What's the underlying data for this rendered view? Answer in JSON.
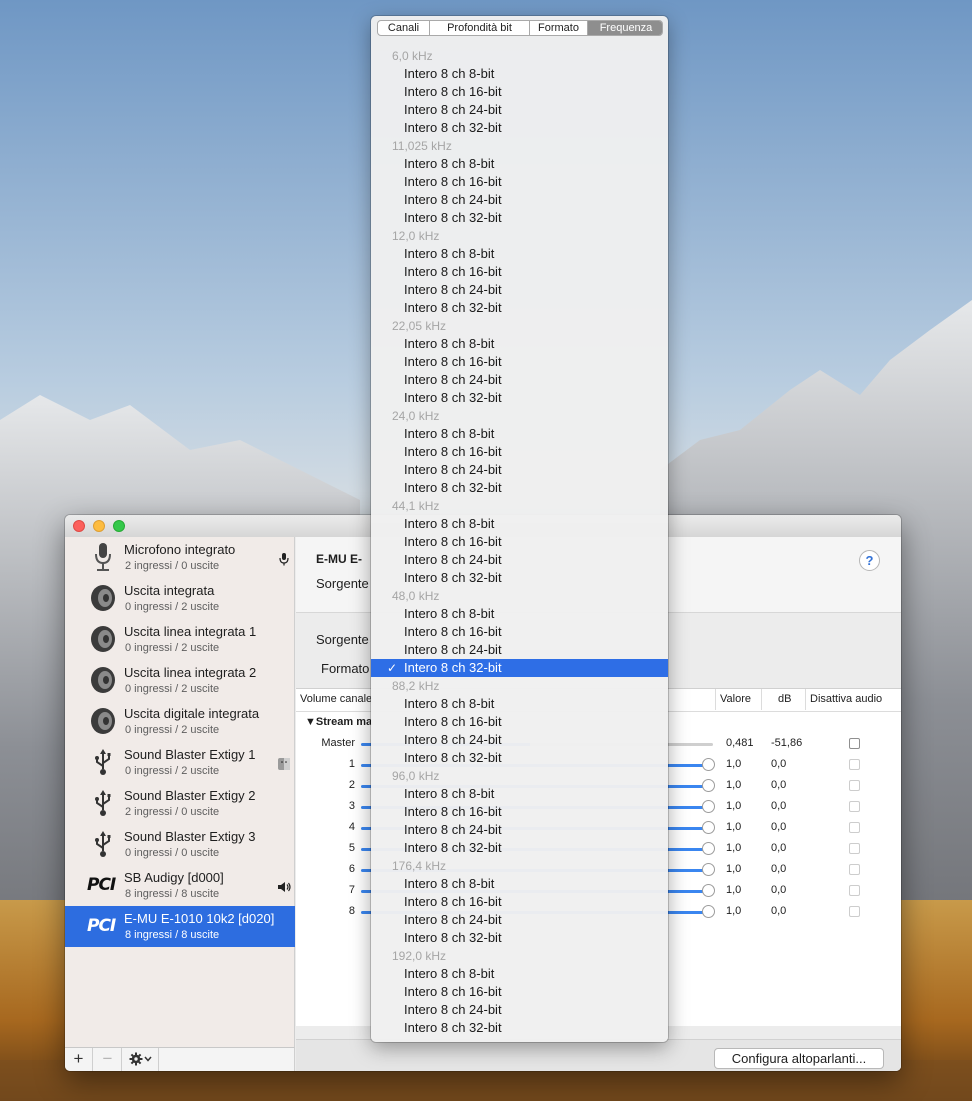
{
  "window": {
    "device_title": "E-MU E-",
    "labels": {
      "sorgente_top": "Sorgente",
      "sorgente": "Sorgente",
      "formato": "Formato"
    },
    "help_label": "?",
    "configure_button": "Configura altoparlanti...",
    "table": {
      "headers": {
        "volume": "Volume canale",
        "value": "Valore",
        "db": "dB",
        "mute": "Disattiva audio"
      },
      "group": "Stream ma",
      "rows": [
        {
          "channel": "Master",
          "value": "0,481",
          "db": "-51,86",
          "level": 0.481
        },
        {
          "channel": "1",
          "value": "1,0",
          "db": "0,0",
          "level": 1.0
        },
        {
          "channel": "2",
          "value": "1,0",
          "db": "0,0",
          "level": 1.0
        },
        {
          "channel": "3",
          "value": "1,0",
          "db": "0,0",
          "level": 1.0
        },
        {
          "channel": "4",
          "value": "1,0",
          "db": "0,0",
          "level": 1.0
        },
        {
          "channel": "5",
          "value": "1,0",
          "db": "0,0",
          "level": 1.0
        },
        {
          "channel": "6",
          "value": "1,0",
          "db": "0,0",
          "level": 1.0
        },
        {
          "channel": "7",
          "value": "1,0",
          "db": "0,0",
          "level": 1.0
        },
        {
          "channel": "8",
          "value": "1,0",
          "db": "0,0",
          "level": 1.0
        }
      ]
    }
  },
  "sidebar": {
    "devices": [
      {
        "name": "Microfono integrato",
        "io": "2 ingressi / 0 uscite",
        "icon": "microphone-icon"
      },
      {
        "name": "Uscita integrata",
        "io": "0 ingressi / 2 uscite",
        "icon": "speaker-icon"
      },
      {
        "name": "Uscita linea integrata 1",
        "io": "0 ingressi / 2 uscite",
        "icon": "speaker-icon"
      },
      {
        "name": "Uscita linea integrata 2",
        "io": "0 ingressi / 2 uscite",
        "icon": "speaker-icon"
      },
      {
        "name": "Uscita digitale integrata",
        "io": "0 ingressi / 2 uscite",
        "icon": "speaker-icon"
      },
      {
        "name": "Sound Blaster Extigy 1",
        "io": "0 ingressi / 2 uscite",
        "icon": "usb-icon"
      },
      {
        "name": "Sound Blaster Extigy 2",
        "io": "2 ingressi / 0 uscite",
        "icon": "usb-icon"
      },
      {
        "name": "Sound Blaster Extigy 3",
        "io": "0 ingressi / 0 uscite",
        "icon": "usb-icon"
      },
      {
        "name": "SB Audigy [d000]",
        "io": "8 ingressi / 8 uscite",
        "icon": "pci-icon",
        "pci": "PCI"
      },
      {
        "name": "E-MU E-1010 10k2 [d020]",
        "io": "8 ingressi / 8 uscite",
        "icon": "pci-icon",
        "pci": "PCI",
        "selected": true
      }
    ],
    "footer": {
      "add": "+",
      "remove": "−"
    }
  },
  "popup": {
    "tabs": [
      "Canali",
      "Profondità bit",
      "Formato",
      "Frequenza"
    ],
    "active_tab": "Frequenza",
    "check_mark": "✓",
    "groups": [
      {
        "label": "6,0 kHz",
        "items": [
          "Intero 8 ch 8-bit",
          "Intero 8 ch 16-bit",
          "Intero 8 ch 24-bit",
          "Intero 8 ch 32-bit"
        ]
      },
      {
        "label": "11,025 kHz",
        "items": [
          "Intero 8 ch 8-bit",
          "Intero 8 ch 16-bit",
          "Intero 8 ch 24-bit",
          "Intero 8 ch 32-bit"
        ]
      },
      {
        "label": "12,0 kHz",
        "items": [
          "Intero 8 ch 8-bit",
          "Intero 8 ch 16-bit",
          "Intero 8 ch 24-bit",
          "Intero 8 ch 32-bit"
        ]
      },
      {
        "label": "22,05 kHz",
        "items": [
          "Intero 8 ch 8-bit",
          "Intero 8 ch 16-bit",
          "Intero 8 ch 24-bit",
          "Intero 8 ch 32-bit"
        ]
      },
      {
        "label": "24,0 kHz",
        "items": [
          "Intero 8 ch 8-bit",
          "Intero 8 ch 16-bit",
          "Intero 8 ch 24-bit",
          "Intero 8 ch 32-bit"
        ]
      },
      {
        "label": "44,1 kHz",
        "items": [
          "Intero 8 ch 8-bit",
          "Intero 8 ch 16-bit",
          "Intero 8 ch 24-bit",
          "Intero 8 ch 32-bit"
        ]
      },
      {
        "label": "48,0 kHz",
        "items": [
          "Intero 8 ch 8-bit",
          "Intero 8 ch 16-bit",
          "Intero 8 ch 24-bit",
          "Intero 8 ch 32-bit"
        ],
        "checked_index": 3
      },
      {
        "label": "88,2 kHz",
        "items": [
          "Intero 8 ch 8-bit",
          "Intero 8 ch 16-bit",
          "Intero 8 ch 24-bit",
          "Intero 8 ch 32-bit"
        ]
      },
      {
        "label": "96,0 kHz",
        "items": [
          "Intero 8 ch 8-bit",
          "Intero 8 ch 16-bit",
          "Intero 8 ch 24-bit",
          "Intero 8 ch 32-bit"
        ]
      },
      {
        "label": "176,4 kHz",
        "items": [
          "Intero 8 ch 8-bit",
          "Intero 8 ch 16-bit",
          "Intero 8 ch 24-bit",
          "Intero 8 ch 32-bit"
        ]
      },
      {
        "label": "192,0 kHz",
        "items": [
          "Intero 8 ch 8-bit",
          "Intero 8 ch 16-bit",
          "Intero 8 ch 24-bit",
          "Intero 8 ch 32-bit"
        ]
      }
    ]
  }
}
